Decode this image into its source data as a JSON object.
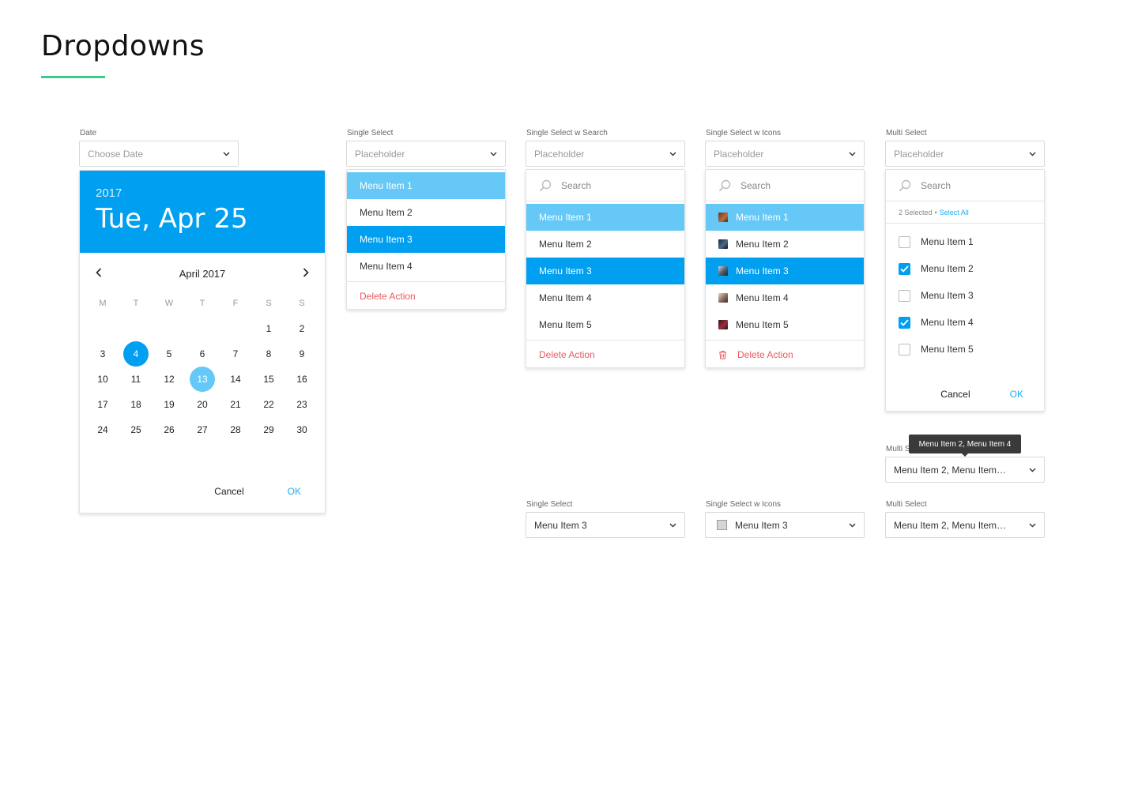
{
  "page": {
    "title": "Dropdowns",
    "accent": "#3dc98b"
  },
  "colors": {
    "primary": "#009ff0",
    "hover": "#66c8f7",
    "danger": "#e85b61",
    "link": "#1aaef5"
  },
  "date": {
    "label": "Date",
    "placeholder": "Choose Date",
    "calendar": {
      "year": "2017",
      "selected_long": "Tue, Apr 25",
      "month_label": "April 2017",
      "weekdays": [
        "M",
        "T",
        "W",
        "T",
        "F",
        "S",
        "S"
      ],
      "weeks": [
        [
          "",
          "",
          "",
          "",
          "",
          "1",
          "2"
        ],
        [
          "3",
          "4",
          "5",
          "6",
          "7",
          "8",
          "9"
        ],
        [
          "10",
          "11",
          "12",
          "13",
          "14",
          "15",
          "16"
        ],
        [
          "17",
          "18",
          "19",
          "20",
          "21",
          "22",
          "23"
        ],
        [
          "24",
          "25",
          "26",
          "27",
          "28",
          "29",
          "30"
        ]
      ],
      "selected_day": "4",
      "highlight_day": "13",
      "cancel": "Cancel",
      "ok": "OK"
    }
  },
  "single": {
    "label": "Single Select",
    "placeholder": "Placeholder",
    "items": [
      "Menu Item 1",
      "Menu Item 2",
      "Menu Item 3",
      "Menu Item 4"
    ],
    "action": "Delete Action"
  },
  "single_search": {
    "label": "Single Select w Search",
    "placeholder": "Placeholder",
    "search_placeholder": "Search",
    "items": [
      "Menu Item 1",
      "Menu Item 2",
      "Menu Item 3",
      "Menu Item 4",
      "Menu Item 5"
    ],
    "action": "Delete Action"
  },
  "single_icons": {
    "label": "Single Select w Icons",
    "placeholder": "Placeholder",
    "search_placeholder": "Search",
    "items": [
      "Menu Item 1",
      "Menu Item 2",
      "Menu Item 3",
      "Menu Item 4",
      "Menu Item 5"
    ],
    "action": "Delete Action"
  },
  "multi": {
    "label": "Multi Select",
    "placeholder": "Placeholder",
    "search_placeholder": "Search",
    "selected_count": "2 Selected",
    "separator": "•",
    "select_all": "Select All",
    "items": [
      "Menu Item 1",
      "Menu Item 2",
      "Menu Item 3",
      "Menu Item 4",
      "Menu Item 5"
    ],
    "checked": [
      false,
      true,
      false,
      true,
      false
    ],
    "cancel": "Cancel",
    "ok": "OK"
  },
  "multi_hover": {
    "label": "Multi Select",
    "value": "Menu Item 2, Menu Item…",
    "tooltip": "Menu Item 2, Menu Item 4"
  },
  "filled": {
    "single": {
      "label": "Single Select",
      "value": "Menu Item 3"
    },
    "single_icons": {
      "label": "Single Select w Icons",
      "value": "Menu Item 3"
    },
    "multi": {
      "label": "Multi Select",
      "value": "Menu Item 2, Menu Item…"
    }
  }
}
